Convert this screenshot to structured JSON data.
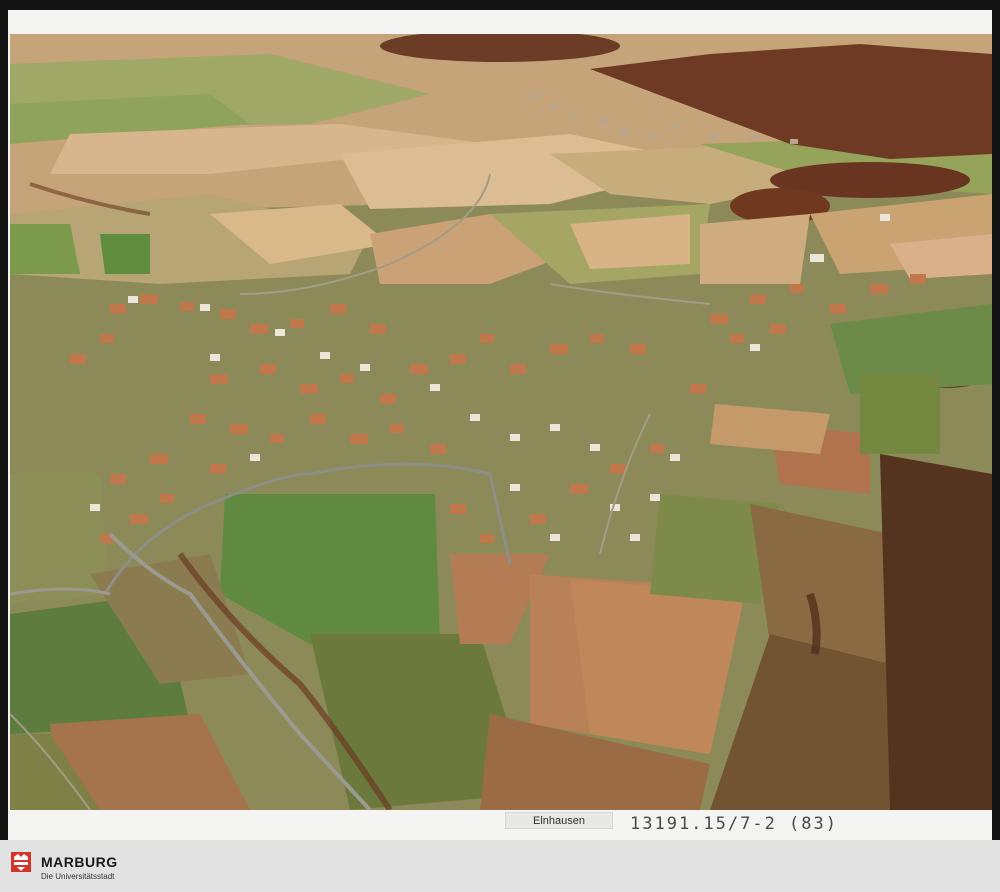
{
  "photo": {
    "kind": "aerial photograph",
    "colors": {
      "field_green": "#6f8a48",
      "field_tan": "#c9a77f",
      "forest_brown": "#6b3c26",
      "roof_orange": "#c0784a"
    }
  },
  "caption": {
    "place": "Elnhausen",
    "archive_number": "13191.15/7-2 (83)"
  },
  "footer": {
    "brand": "MARBURG",
    "subtitle": "Die Universitätsstadt",
    "logo_color": "#d4342a"
  }
}
